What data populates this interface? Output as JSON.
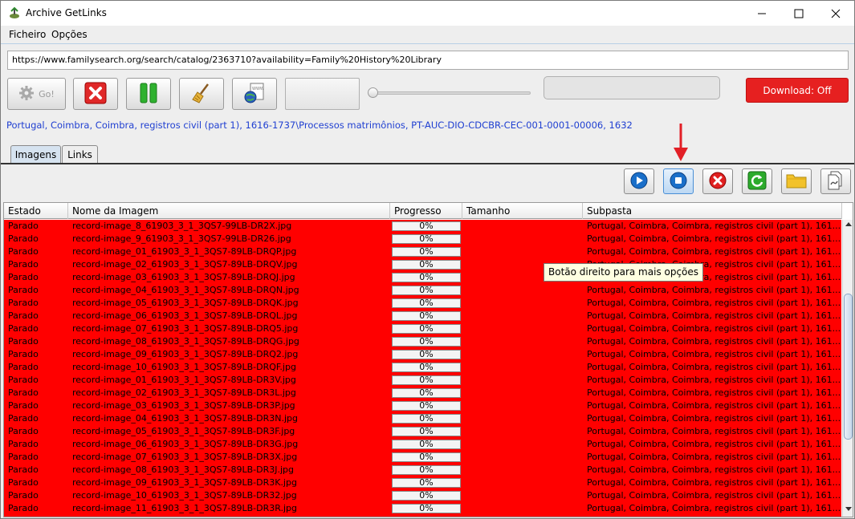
{
  "window": {
    "title": "Archive GetLinks"
  },
  "menu": [
    "Ficheiro",
    "Opções"
  ],
  "url": "https://www.familysearch.org/search/catalog/2363710?availability=Family%20History%20Library",
  "toolbar": {
    "go_label": "Go!",
    "download_label": "Download: Off"
  },
  "path": "Portugal, Coimbra, Coimbra, registros civil (part 1), 1616-1737\\Processos matrimônios, PT-AUC-DIO-CDCBR-CEC-001-0001-00006, 1632",
  "tabs": [
    "Imagens",
    "Links"
  ],
  "tooltip": "Botão direito para mais opções",
  "colors": {
    "download_bg": "#e62020",
    "row_bg": "#ff0000",
    "path_text": "#1f3fd1"
  },
  "table": {
    "headers": [
      "Estado",
      "Nome da Imagem",
      "Progresso",
      "Tamanho",
      "Subpasta"
    ],
    "rows": [
      {
        "estado": "Parado",
        "nome": "record-image_8_61903_3_1_3QS7-99LB-DR2X.jpg",
        "progresso": "0%",
        "tamanho": "",
        "subpasta": "Portugal, Coimbra, Coimbra, registros civil (part 1), 161..."
      },
      {
        "estado": "Parado",
        "nome": "record-image_9_61903_3_1_3QS7-99LB-DR26.jpg",
        "progresso": "0%",
        "tamanho": "",
        "subpasta": "Portugal, Coimbra, Coimbra, registros civil (part 1), 161..."
      },
      {
        "estado": "Parado",
        "nome": "record-image_01_61903_3_1_3QS7-89LB-DRQP.jpg",
        "progresso": "0%",
        "tamanho": "",
        "subpasta": "Portugal, Coimbra, Coimbra, registros civil (part 1), 161..."
      },
      {
        "estado": "Parado",
        "nome": "record-image_02_61903_3_1_3QS7-89LB-DRQV.jpg",
        "progresso": "0%",
        "tamanho": "",
        "subpasta": "Portugal, Coimbra, Coimbra, registros civil (part 1), 161..."
      },
      {
        "estado": "Parado",
        "nome": "record-image_03_61903_3_1_3QS7-89LB-DRQJ.jpg",
        "progresso": "0%",
        "tamanho": "",
        "subpasta": "Portugal, Coimbra, Coimbra, registros civil (part 1), 161..."
      },
      {
        "estado": "Parado",
        "nome": "record-image_04_61903_3_1_3QS7-89LB-DRQN.jpg",
        "progresso": "0%",
        "tamanho": "",
        "subpasta": "Portugal, Coimbra, Coimbra, registros civil (part 1), 161..."
      },
      {
        "estado": "Parado",
        "nome": "record-image_05_61903_3_1_3QS7-89LB-DRQK.jpg",
        "progresso": "0%",
        "tamanho": "",
        "subpasta": "Portugal, Coimbra, Coimbra, registros civil (part 1), 161..."
      },
      {
        "estado": "Parado",
        "nome": "record-image_06_61903_3_1_3QS7-89LB-DRQL.jpg",
        "progresso": "0%",
        "tamanho": "",
        "subpasta": "Portugal, Coimbra, Coimbra, registros civil (part 1), 161..."
      },
      {
        "estado": "Parado",
        "nome": "record-image_07_61903_3_1_3QS7-89LB-DRQ5.jpg",
        "progresso": "0%",
        "tamanho": "",
        "subpasta": "Portugal, Coimbra, Coimbra, registros civil (part 1), 161..."
      },
      {
        "estado": "Parado",
        "nome": "record-image_08_61903_3_1_3QS7-89LB-DRQG.jpg",
        "progresso": "0%",
        "tamanho": "",
        "subpasta": "Portugal, Coimbra, Coimbra, registros civil (part 1), 161..."
      },
      {
        "estado": "Parado",
        "nome": "record-image_09_61903_3_1_3QS7-89LB-DRQ2.jpg",
        "progresso": "0%",
        "tamanho": "",
        "subpasta": "Portugal, Coimbra, Coimbra, registros civil (part 1), 161..."
      },
      {
        "estado": "Parado",
        "nome": "record-image_10_61903_3_1_3QS7-89LB-DRQF.jpg",
        "progresso": "0%",
        "tamanho": "",
        "subpasta": "Portugal, Coimbra, Coimbra, registros civil (part 1), 161..."
      },
      {
        "estado": "Parado",
        "nome": "record-image_01_61903_3_1_3QS7-89LB-DR3V.jpg",
        "progresso": "0%",
        "tamanho": "",
        "subpasta": "Portugal, Coimbra, Coimbra, registros civil (part 1), 161..."
      },
      {
        "estado": "Parado",
        "nome": "record-image_02_61903_3_1_3QS7-89LB-DR3L.jpg",
        "progresso": "0%",
        "tamanho": "",
        "subpasta": "Portugal, Coimbra, Coimbra, registros civil (part 1), 161..."
      },
      {
        "estado": "Parado",
        "nome": "record-image_03_61903_3_1_3QS7-89LB-DR3P.jpg",
        "progresso": "0%",
        "tamanho": "",
        "subpasta": "Portugal, Coimbra, Coimbra, registros civil (part 1), 161..."
      },
      {
        "estado": "Parado",
        "nome": "record-image_04_61903_3_1_3QS7-89LB-DR3N.jpg",
        "progresso": "0%",
        "tamanho": "",
        "subpasta": "Portugal, Coimbra, Coimbra, registros civil (part 1), 161..."
      },
      {
        "estado": "Parado",
        "nome": "record-image_05_61903_3_1_3QS7-89LB-DR3F.jpg",
        "progresso": "0%",
        "tamanho": "",
        "subpasta": "Portugal, Coimbra, Coimbra, registros civil (part 1), 161..."
      },
      {
        "estado": "Parado",
        "nome": "record-image_06_61903_3_1_3QS7-89LB-DR3G.jpg",
        "progresso": "0%",
        "tamanho": "",
        "subpasta": "Portugal, Coimbra, Coimbra, registros civil (part 1), 161..."
      },
      {
        "estado": "Parado",
        "nome": "record-image_07_61903_3_1_3QS7-89LB-DR3X.jpg",
        "progresso": "0%",
        "tamanho": "",
        "subpasta": "Portugal, Coimbra, Coimbra, registros civil (part 1), 161..."
      },
      {
        "estado": "Parado",
        "nome": "record-image_08_61903_3_1_3QS7-89LB-DR3J.jpg",
        "progresso": "0%",
        "tamanho": "",
        "subpasta": "Portugal, Coimbra, Coimbra, registros civil (part 1), 161..."
      },
      {
        "estado": "Parado",
        "nome": "record-image_09_61903_3_1_3QS7-89LB-DR3K.jpg",
        "progresso": "0%",
        "tamanho": "",
        "subpasta": "Portugal, Coimbra, Coimbra, registros civil (part 1), 161..."
      },
      {
        "estado": "Parado",
        "nome": "record-image_10_61903_3_1_3QS7-89LB-DR32.jpg",
        "progresso": "0%",
        "tamanho": "",
        "subpasta": "Portugal, Coimbra, Coimbra, registros civil (part 1), 161..."
      },
      {
        "estado": "Parado",
        "nome": "record-image_11_61903_3_1_3QS7-89LB-DR3R.jpg",
        "progresso": "0%",
        "tamanho": "",
        "subpasta": "Portugal, Coimbra, Coimbra, registros civil (part 1), 161..."
      }
    ]
  }
}
